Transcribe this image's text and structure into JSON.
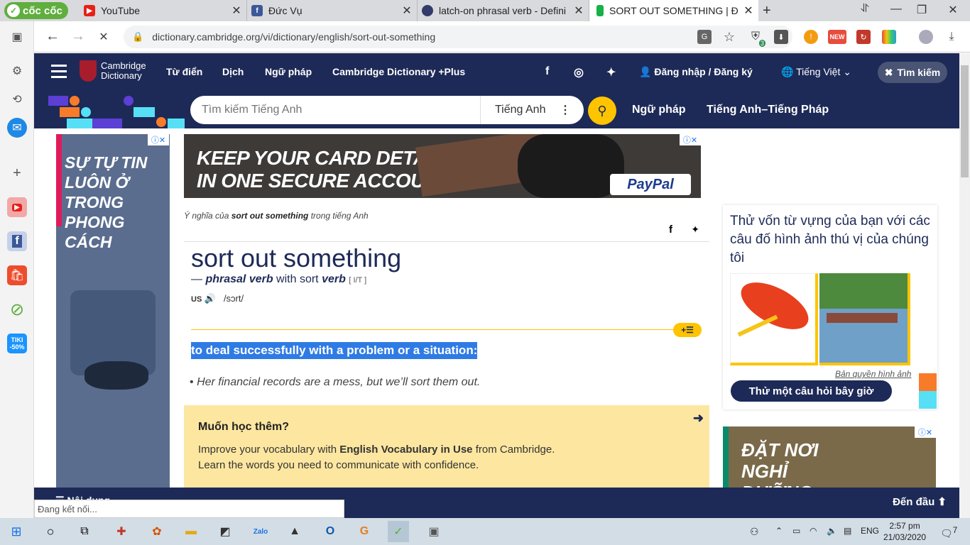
{
  "browser": {
    "brand": "cốc cốc",
    "tabs": [
      {
        "title": "YouTube",
        "favicon": "youtube-icon",
        "color": "#e62117"
      },
      {
        "title": "Đức Vụ",
        "favicon": "facebook-icon",
        "color": "#3b5998"
      },
      {
        "title": "latch-on phrasal verb - Defini",
        "favicon": "cambridge-icon",
        "color": "#333b6b"
      },
      {
        "title": "SORT OUT SOMETHING | Định",
        "favicon": "cambridge-green-icon",
        "color": "#17b148",
        "active": true
      }
    ],
    "url": "dictionary.cambridge.org/vi/dictionary/english/sort-out-something",
    "status_text": "Đang kết nối...",
    "ext_badge_new": "NEW",
    "ext_badge_count": "3"
  },
  "site": {
    "logo_line1": "Cambridge",
    "logo_line2": "Dictionary",
    "nav": [
      "Từ điển",
      "Dịch",
      "Ngữ pháp",
      "Cambridge Dictionary +Plus"
    ],
    "login": "Đăng nhập / Đăng ký",
    "language": "Tiếng Việt",
    "search_toggle": "Tìm kiếm",
    "search_placeholder": "Tìm kiếm Tiếng Anh",
    "search_lang": "Tiếng Anh",
    "row2_links": [
      "Ngữ pháp",
      "Tiếng Anh–Tiếng Pháp"
    ],
    "footer_left": "Nội dung",
    "footer_totop": "Đến đầu"
  },
  "ads": {
    "left_text": "SỰ TỰ TIN LUÔN Ở TRONG PHONG CÁCH",
    "top_line1": "KEEP YOUR CARD DETAILS",
    "top_line2": "IN ONE SECURE ACCOUNT",
    "top_brand": "PayPal",
    "right_text_1": "ĐẶT NƠI",
    "right_text_2": "NGHỈ",
    "right_text_3": "DƯỠNG"
  },
  "entry": {
    "crumb_pre": "Ý nghĩa của ",
    "crumb_word": "sort out something",
    "crumb_post": " trong tiếng Anh",
    "headword": "sort out something",
    "pos_dash": "— ",
    "pos": "phrasal verb",
    "pos_with": " with sort ",
    "pos_verb": "verb",
    "grammar": "[ I/T ]",
    "region": "US",
    "ipa": "/sɔrt/",
    "add_btn": "+",
    "definition": "to deal successfully with a problem or a situation:",
    "example_bullet": "•",
    "example": "Her financial records are a mess, but we’ll sort them out."
  },
  "learn_more": {
    "title": "Muốn học thêm?",
    "line1_pre": "Improve your vocabulary with ",
    "line1_bold": "English Vocabulary in Use",
    "line1_post": " from Cambridge.",
    "line2": "Learn the words you need to communicate with confidence."
  },
  "quiz": {
    "question": "Thử vốn từ vựng của bạn với các câu đố hình ảnh thú vị của chúng tôi",
    "copyright": "Bản quyền hình ảnh",
    "button": "Thử một câu hỏi bây giờ"
  },
  "taskbar": {
    "lang": "ENG",
    "time": "2:57 pm",
    "date": "21/03/2020",
    "notif": "7"
  }
}
